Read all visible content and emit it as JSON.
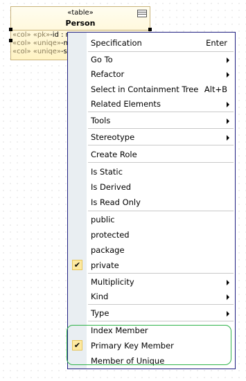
{
  "element": {
    "stereotype": "«table»",
    "name": "Person",
    "attributes": [
      {
        "stereo": "«col» «pk»",
        "text": "-id : n"
      },
      {
        "stereo": "«col» «uniqe»",
        "text": "-na"
      },
      {
        "stereo": "«col» «uniqe»",
        "text": "-su"
      }
    ]
  },
  "menu": {
    "specification": {
      "label": "Specification",
      "shortcut": "Enter"
    },
    "go_to": "Go To",
    "refactor": "Refactor",
    "select_containment": {
      "label": "Select in Containment Tree",
      "shortcut": "Alt+B"
    },
    "related_elements": "Related Elements",
    "tools": "Tools",
    "stereotype": "Stereotype",
    "create_role": "Create Role",
    "is_static": "Is Static",
    "is_derived": "Is Derived",
    "is_read_only": "Is Read Only",
    "public": "public",
    "protected": "protected",
    "package": "package",
    "private": "private",
    "multiplicity": "Multiplicity",
    "kind": "Kind",
    "type": "Type",
    "index_member": "Index Member",
    "primary_key_member": "Primary Key Member",
    "member_of_unique": "Member of Unique"
  },
  "colors": {
    "highlight": "#2fb34a",
    "menu_border": "#1f1f80",
    "check_bg": "#fde9a0"
  }
}
